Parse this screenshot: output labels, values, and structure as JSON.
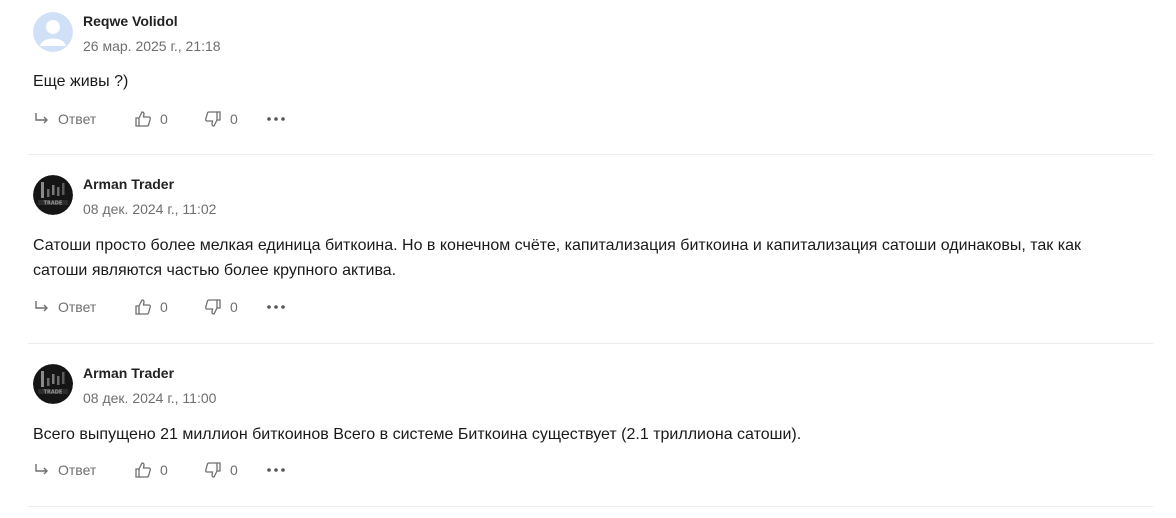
{
  "comments": [
    {
      "author": "Reqwe Volidol",
      "date": "26 мар. 2025 г., 21:18",
      "text": "Еще живы ?)",
      "avatar": "default-user-avatar",
      "reply_label": "Ответ",
      "likes": "0",
      "dislikes": "0"
    },
    {
      "author": "Arman Trader",
      "date": "08 дек. 2024 г., 11:02",
      "text": "Сатоши просто более мелкая единица биткоина. Но в конечном счёте, капитализация биткоина и капитализация сатоши одинаковы, так как сатоши являются частью более крупного актива.",
      "avatar": "candlestick-trader-avatar",
      "reply_label": "Ответ",
      "likes": "0",
      "dislikes": "0"
    },
    {
      "author": "Arman Trader",
      "date": "08 дек. 2024 г., 11:00",
      "text": "Всего выпущено 21 миллион биткоинов Всего в системе Биткоина существует (2.1 триллиона сатоши).",
      "avatar": "candlestick-trader-avatar",
      "reply_label": "Ответ",
      "likes": "0",
      "dislikes": "0"
    }
  ],
  "colors": {
    "muted": "#6f6f6f",
    "divider": "#ececec",
    "default_avatar": "#cfe0f7"
  }
}
